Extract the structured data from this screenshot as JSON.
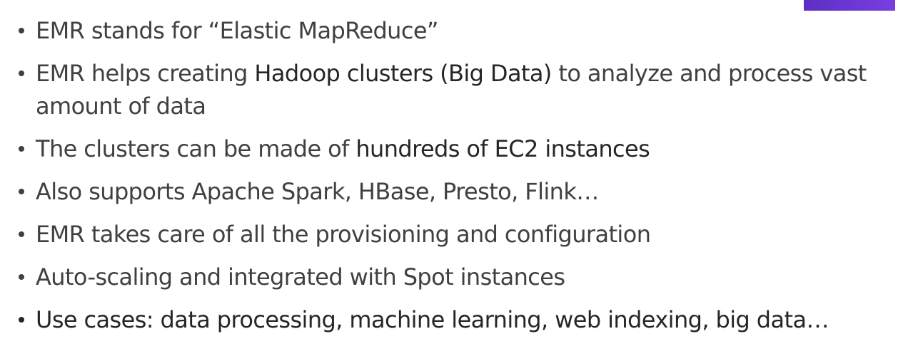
{
  "bullets": [
    {
      "parts": [
        "EMR stands for “Elastic MapReduce”"
      ]
    },
    {
      "parts": [
        "EMR helps creating ",
        "Hadoop clusters (Big Data)",
        " to analyze and process vast amount of data"
      ]
    },
    {
      "parts": [
        "The clusters can be made of ",
        "hundreds of EC2 instances"
      ]
    },
    {
      "parts": [
        "Also supports Apache Spark, HBase, Presto, Flink…"
      ]
    },
    {
      "parts": [
        "EMR takes care of all the provisioning and configuration"
      ]
    },
    {
      "parts": [
        "Auto-scaling and integrated with Spot instances"
      ]
    },
    {
      "parts": [
        "Use cases: data processing, machine learning, web indexing, big data…"
      ]
    }
  ],
  "colors": {
    "text": "#404040",
    "emphasis": "#262626",
    "accent": "#6a35d6"
  }
}
